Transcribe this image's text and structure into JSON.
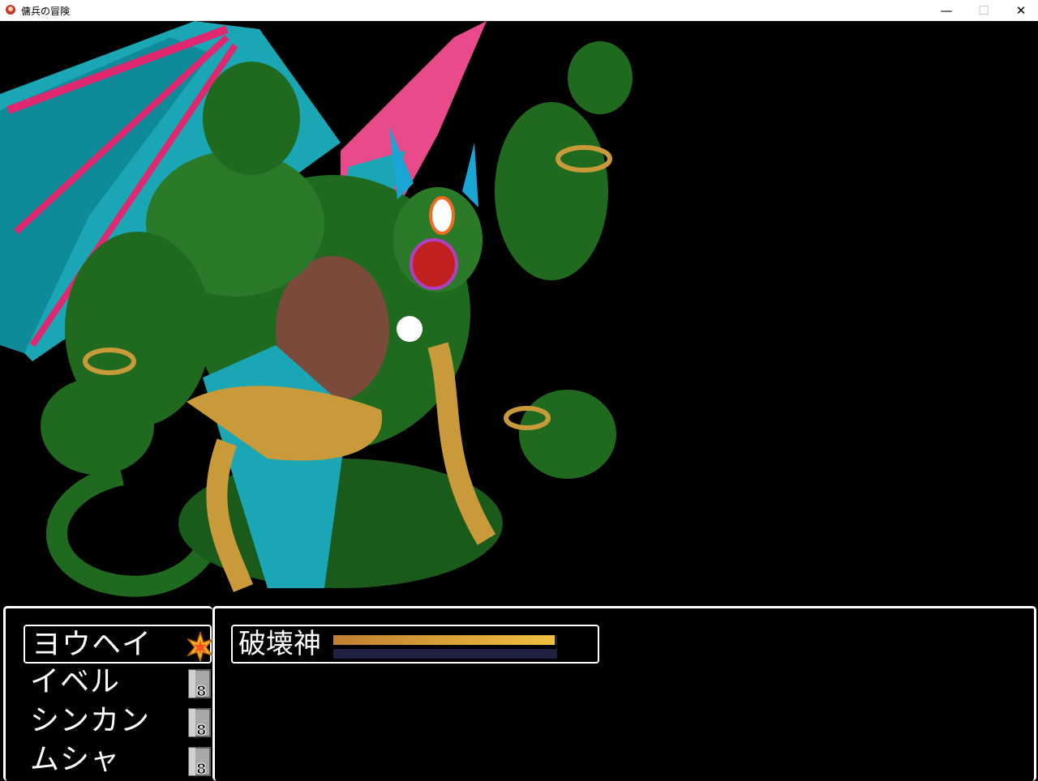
{
  "window": {
    "title": "傭兵の冒険",
    "minimize_icon": "minimize-icon",
    "maximize_icon": "maximize-icon",
    "close_icon": "close-icon",
    "minimize_glyph": "—",
    "maximize_glyph": "☐",
    "close_glyph": "✕"
  },
  "scene": {
    "enemy_sprite": "destruction-god-demon"
  },
  "party": {
    "members": [
      {
        "name": "ヨウヘイ",
        "state_icon": "turn-star-icon",
        "selected": true
      },
      {
        "name": "イベル",
        "state_icon": "waiting-door-icon",
        "badge": "8"
      },
      {
        "name": "シンカン",
        "state_icon": "waiting-door-icon",
        "badge": "8"
      },
      {
        "name": "ムシャ",
        "state_icon": "waiting-door-icon",
        "badge": "8"
      }
    ]
  },
  "enemies": [
    {
      "name": "破壊神",
      "hp_fraction": 0.99,
      "mp_fraction": 0
    }
  ],
  "colors": {
    "hp_gauge": "#f0c040",
    "gauge_back": "#202040",
    "border": "#ffffff",
    "demon_green": "#1f6a1f",
    "wing_cyan": "#1aa6b4",
    "wing_pink": "#e02870"
  }
}
